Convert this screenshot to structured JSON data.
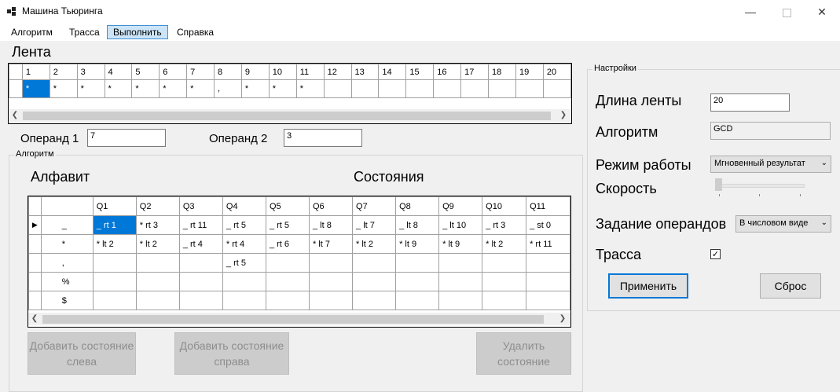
{
  "window": {
    "title": "Машина Тьюринга"
  },
  "menu": [
    "Алгоритм",
    "Трасса",
    "Выполнить",
    "Справка"
  ],
  "tape": {
    "label": "Лента",
    "indices": [
      "1",
      "2",
      "3",
      "4",
      "5",
      "6",
      "7",
      "8",
      "9",
      "10",
      "11",
      "12",
      "13",
      "14",
      "15",
      "16",
      "17",
      "18",
      "19",
      "20"
    ],
    "cells": [
      "*",
      "*",
      "*",
      "*",
      "*",
      "*",
      "*",
      ",",
      "*",
      "*",
      "*",
      "",
      "",
      "",
      "",
      "",
      "",
      "",
      "",
      ""
    ]
  },
  "operands": {
    "op1_label": "Операнд 1",
    "op1_value": "7",
    "op2_label": "Операнд 2",
    "op2_value": "3"
  },
  "algorithm": {
    "group_label": "Алгоритм",
    "alphabet_label": "Алфавит",
    "states_label": "Состояния",
    "columns": [
      "Q1",
      "Q2",
      "Q3",
      "Q4",
      "Q5",
      "Q6",
      "Q7",
      "Q8",
      "Q9",
      "Q10",
      "Q11"
    ],
    "rows": [
      {
        "symbol": "_",
        "cells": [
          "_ rt 1",
          "* rt 3",
          "_ rt 11",
          "_ rt 5",
          "_ rt 5",
          "_ lt 8",
          "_ lt 7",
          "_ lt 8",
          "_ lt 10",
          "_ rt 3",
          "_ st 0"
        ]
      },
      {
        "symbol": "*",
        "cells": [
          "* lt 2",
          "* lt 2",
          "_ rt 4",
          "* rt 4",
          "_ rt 6",
          "* lt 7",
          "* lt 2",
          "* lt 9",
          "* lt 9",
          "* lt 2",
          "* rt 11"
        ]
      },
      {
        "symbol": ",",
        "cells": [
          "",
          "",
          "",
          "_ rt 5",
          "",
          "",
          "",
          "",
          "",
          "",
          ""
        ]
      },
      {
        "symbol": "%",
        "cells": [
          "",
          "",
          "",
          "",
          "",
          "",
          "",
          "",
          "",
          "",
          ""
        ]
      },
      {
        "symbol": "$",
        "cells": [
          "",
          "",
          "",
          "",
          "",
          "",
          "",
          "",
          "",
          "",
          ""
        ]
      }
    ],
    "btn_add_left": "Добавить состояние слева",
    "btn_add_right": "Добавить состояние справа",
    "btn_delete": "Удалить состояние"
  },
  "settings": {
    "group_label": "Настройки",
    "tape_length_label": "Длина ленты",
    "tape_length_value": "20",
    "algorithm_label": "Алгоритм",
    "algorithm_value": "GCD",
    "mode_label": "Режим работы",
    "mode_value": "Мгновенный результат",
    "speed_label": "Скорость",
    "speed_level": 0,
    "operand_input_label": "Задание операндов",
    "operand_input_value": "В числовом виде",
    "trace_label": "Трасса",
    "trace_checked": true,
    "apply_label": "Применить",
    "reset_label": "Сброс"
  }
}
